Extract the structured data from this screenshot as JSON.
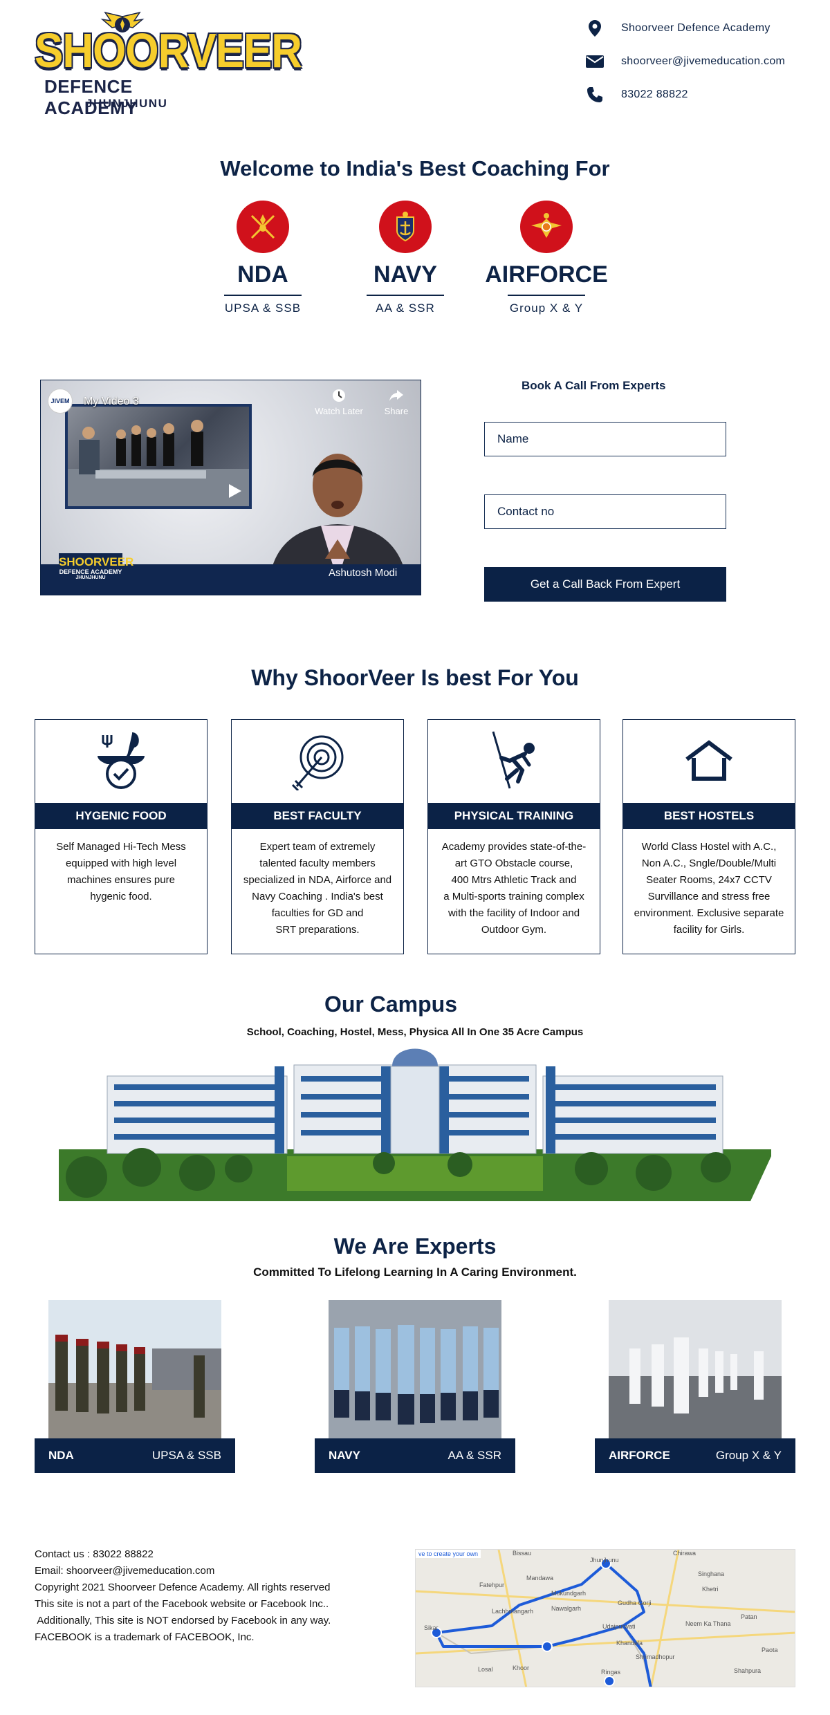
{
  "brand": {
    "logo_word": "SHOORVEER",
    "logo_line1": "DEFENCE ACADEMY",
    "logo_line2": "JHUNJHUNU"
  },
  "contact": {
    "address": "Shoorveer Defence Academy",
    "email": "shoorveer@jivemeducation.com",
    "phone": "83022 88822"
  },
  "welcome": {
    "title": "Welcome to India's Best Coaching For",
    "branches": [
      {
        "name": "NDA",
        "sub": "UPSA & SSB"
      },
      {
        "name": "NAVY",
        "sub": "AA & SSR"
      },
      {
        "name": "AIRFORCE",
        "sub": "Group X & Y"
      }
    ]
  },
  "video": {
    "channel": "JIVEM",
    "title": "My Video 3",
    "watch_later": "Watch Later",
    "share": "Share",
    "speaker_name": "Ashutosh Modi",
    "inset_logo_word": "SHOORVEER",
    "inset_logo_line1": "DEFENCE ACADEMY",
    "inset_logo_line2": "JHUNJHUNU"
  },
  "form": {
    "title": "Book A Call From Experts",
    "name_placeholder": "Name",
    "contact_placeholder": "Contact no",
    "submit_label": "Get a Call Back From Expert"
  },
  "why": {
    "title": "Why ShoorVeer Is best For You",
    "cards": [
      {
        "title": "HYGENIC FOOD",
        "desc": [
          "Self Managed Hi-Tech Mess",
          "equipped with high level",
          "machines ensures pure",
          "hygenic food."
        ]
      },
      {
        "title": "BEST FACULTY",
        "desc": [
          "Expert team of extremely",
          "talented faculty members",
          "specialized in NDA, Airforce and",
          "Navy Coaching . India's best",
          "faculties for GD and",
          "SRT preparations."
        ]
      },
      {
        "title": "PHYSICAL TRAINING",
        "desc": [
          "Academy provides state-of-the-",
          "art GTO Obstacle course,",
          "400 Mtrs Athletic Track and",
          "a Multi-sports training complex",
          "with the facility of Indoor and",
          "Outdoor Gym."
        ]
      },
      {
        "title": "BEST HOSTELS",
        "desc": [
          "World Class Hostel with A.C.,",
          "Non A.C., Sngle/Double/Multi",
          "Seater Rooms, 24x7 CCTV",
          "Survillance and stress free",
          "environment. Exclusive separate",
          "facility for Girls."
        ]
      }
    ]
  },
  "campus": {
    "title": "Our Campus",
    "subtitle": "School, Coaching, Hostel, Mess, Physica All In One 35 Acre Campus"
  },
  "experts": {
    "title": "We Are Experts",
    "subtitle": "Committed To Lifelong Learning In A Caring Environment.",
    "items": [
      {
        "name": "NDA",
        "sub": "UPSA & SSB"
      },
      {
        "name": "NAVY",
        "sub": "AA & SSR"
      },
      {
        "name": "AIRFORCE",
        "sub": "Group X & Y"
      }
    ]
  },
  "footer": {
    "lines": [
      "Contact us : 83022 88822",
      "Email: shoorveer@jivemeducation.com",
      "Copyright 2021 Shoorveer Defence Academy. All rights reserved",
      "This site is not a part of the Facebook website or Facebook Inc..",
      " Additionally, This site is NOT endorsed by Facebook in any way.",
      "FACEBOOK is a trademark of FACEBOOK, Inc."
    ],
    "map": {
      "overlay": "ve to create your own",
      "places": [
        "Bissau",
        "Jhunjhunu",
        "Chirawa",
        "Singhana",
        "Mandawa",
        "Fatehpur",
        "Mukundgarh",
        "Nawalgarh",
        "Gudha Gorji",
        "Khetri",
        "Lachhmangarh",
        "Udaipurwati",
        "Neem Ka Thana",
        "Patan",
        "Sikar",
        "Khandela",
        "Shrimadhopur",
        "Paota",
        "Losal",
        "Khoor",
        "Ringas",
        "Shahpura"
      ]
    }
  },
  "colors": {
    "navy": "#0b2246",
    "logo_yellow": "#f6cd2c",
    "emblem_red": "#d0111b",
    "route_blue": "#1d5bd8"
  }
}
